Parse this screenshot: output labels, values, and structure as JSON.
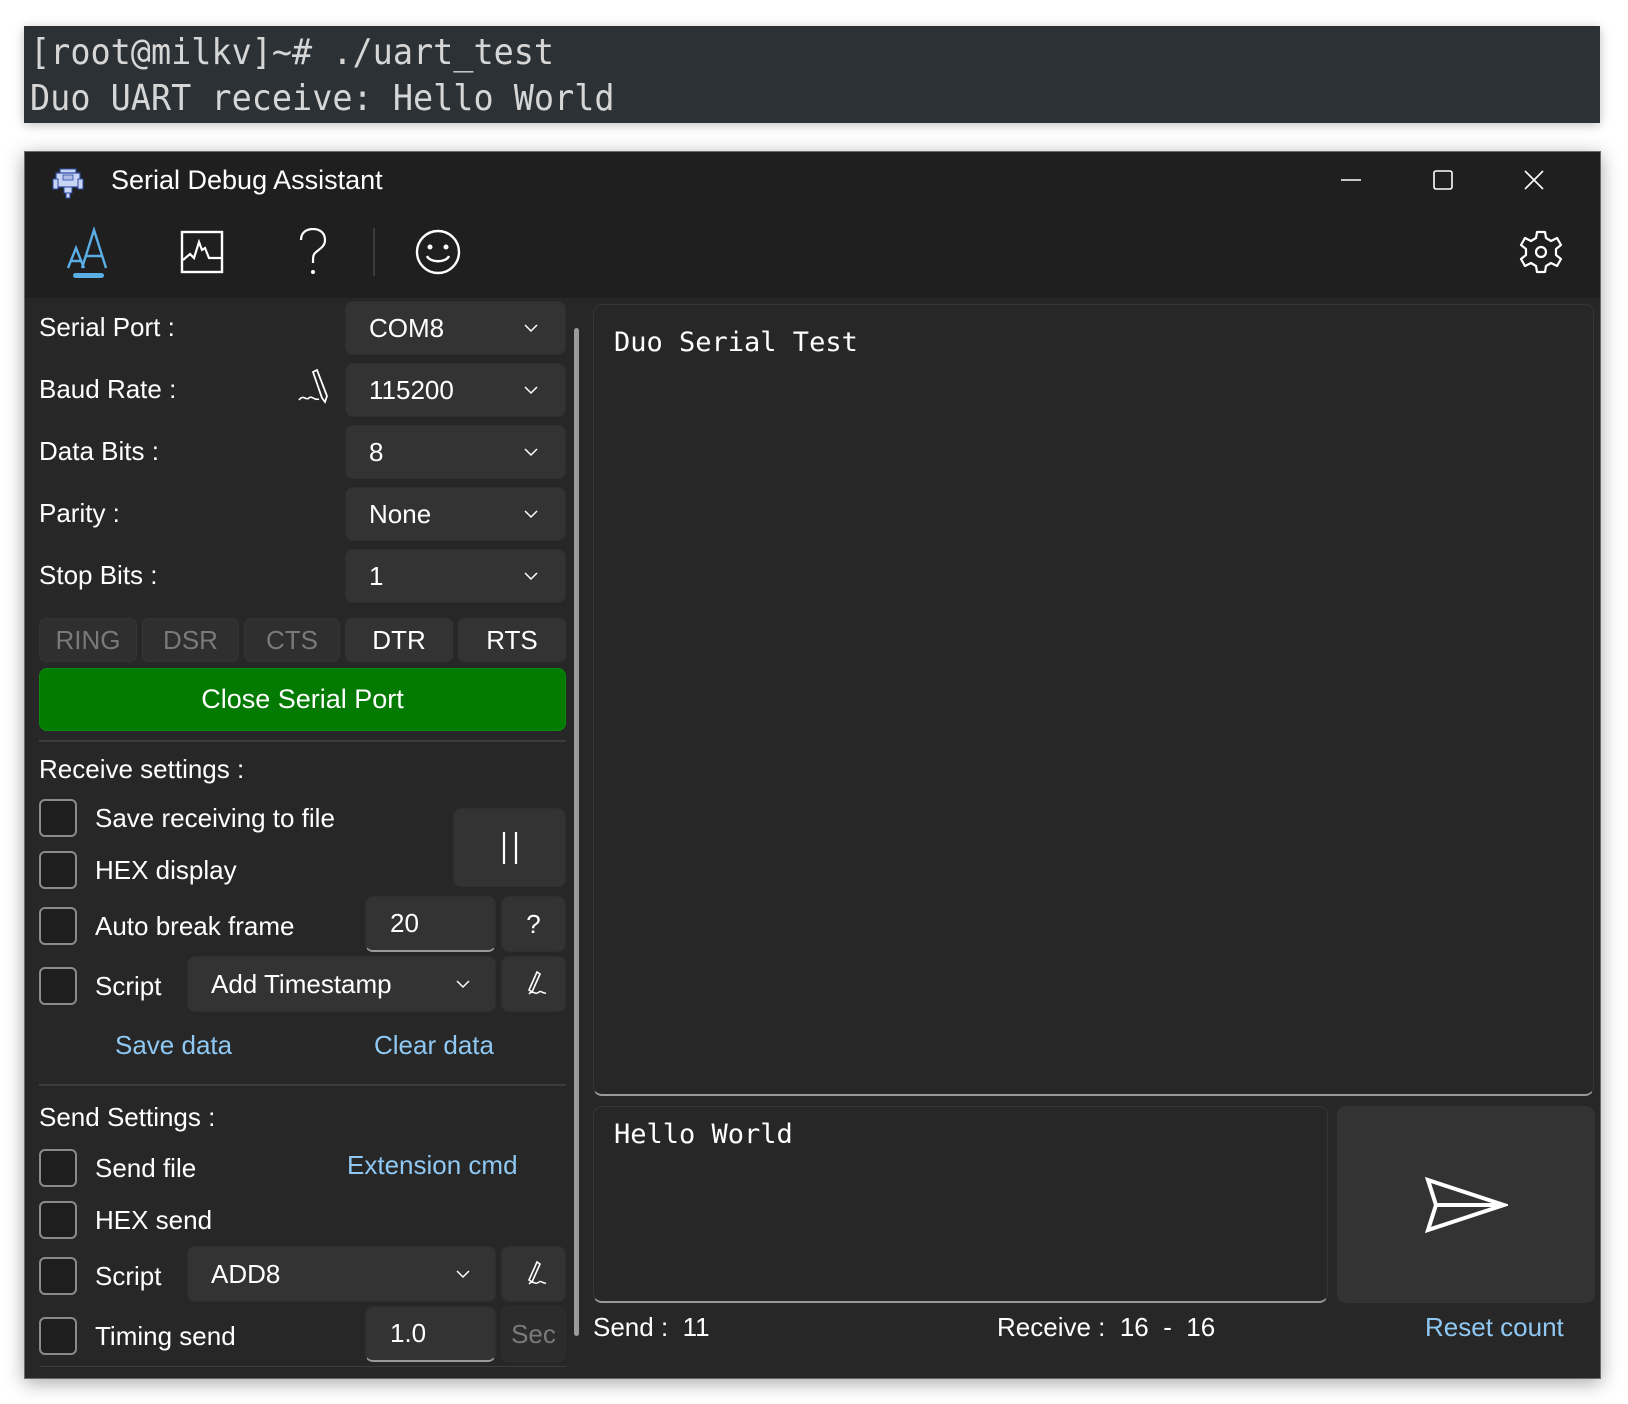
{
  "terminal": {
    "lines": [
      "[root@milkv]~# ./uart_test",
      "Duo UART receive: Hello World"
    ]
  },
  "window": {
    "title": "Serial Debug Assistant",
    "icon": "serial-port-icon",
    "controls": {
      "minimize": "minimize-icon",
      "maximize": "maximize-icon",
      "close": "close-icon"
    }
  },
  "toolbar": {
    "items": [
      {
        "name": "text-mode",
        "icon": "font-aa-icon",
        "active": true
      },
      {
        "name": "chart-mode",
        "icon": "waveform-chart-icon",
        "active": false
      },
      {
        "name": "help",
        "icon": "question-icon",
        "label": "?",
        "active": false
      },
      {
        "name": "feedback",
        "icon": "smiley-icon",
        "active": false
      }
    ],
    "settings_icon": "gear-icon",
    "accent": "#5aaee6"
  },
  "port_settings": {
    "serial_port": {
      "label": "Serial Port :",
      "value": "COM8"
    },
    "baud_rate": {
      "label": "Baud Rate :",
      "value": "115200",
      "edit_icon": "pen-signature-icon"
    },
    "data_bits": {
      "label": "Data Bits :",
      "value": "8"
    },
    "parity": {
      "label": "Parity :",
      "value": "None"
    },
    "stop_bits": {
      "label": "Stop Bits :",
      "value": "1"
    },
    "signals": [
      {
        "label": "RING",
        "active": false
      },
      {
        "label": "DSR",
        "active": false
      },
      {
        "label": "CTS",
        "active": false
      },
      {
        "label": "DTR",
        "active": true
      },
      {
        "label": "RTS",
        "active": true
      }
    ],
    "close_button": "Close Serial Port",
    "close_button_color": "#037b03"
  },
  "receive_settings": {
    "title": "Receive settings :",
    "save_to_file": {
      "label": "Save receiving to file",
      "checked": false
    },
    "hex_display": {
      "label": "HEX display",
      "checked": false
    },
    "auto_break": {
      "label": "Auto break frame",
      "checked": false,
      "value": "20",
      "help": "?"
    },
    "script": {
      "label": "Script",
      "checked": false,
      "value": "Add Timestamp"
    },
    "pause_label": "||",
    "save_data": "Save data",
    "clear_data": "Clear data"
  },
  "send_settings": {
    "title": "Send Settings :",
    "send_file": {
      "label": "Send file",
      "checked": false
    },
    "extension_cmd": "Extension cmd",
    "hex_send": {
      "label": "HEX send",
      "checked": false
    },
    "script": {
      "label": "Script",
      "checked": false,
      "value": "ADD8"
    },
    "timing_send": {
      "label": "Timing send",
      "checked": false,
      "value": "1.0",
      "unit": "Sec"
    }
  },
  "receive_area": {
    "text": "Duo Serial Test"
  },
  "send_area": {
    "text": "Hello World"
  },
  "status": {
    "send_label": "Send :  11",
    "receive_label": "Receive :  16  -  16",
    "reset": "Reset count"
  },
  "colors": {
    "link": "#8fc8f2",
    "background": "#272727",
    "titlebar": "#1f1f1f"
  }
}
